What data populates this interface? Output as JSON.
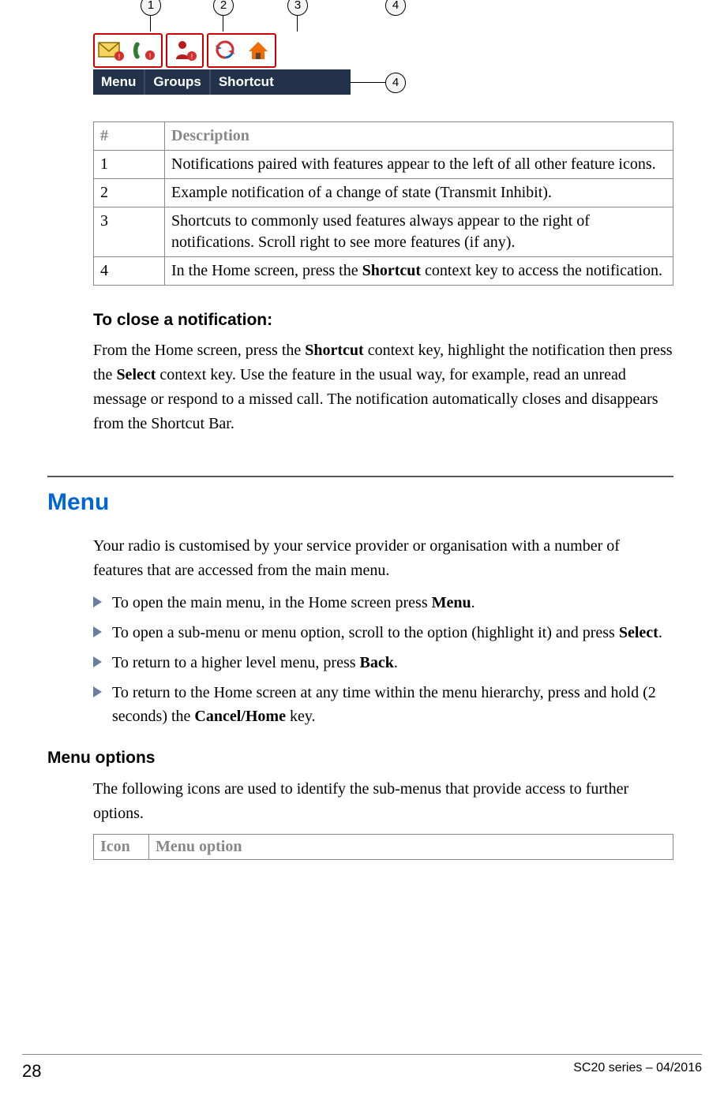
{
  "figure": {
    "callouts": [
      "1",
      "2",
      "3",
      "4"
    ],
    "menubar": [
      "Menu",
      "Groups",
      "Shortcut"
    ]
  },
  "table": {
    "headers": [
      "#",
      "Description"
    ],
    "rows": [
      {
        "n": "1",
        "d_pre": "Notifications paired with features appear to the left of all other feature icons.",
        "d_bold": "",
        "d_post": ""
      },
      {
        "n": "2",
        "d_pre": "Example notification of a change of state (Transmit Inhibit).",
        "d_bold": "",
        "d_post": ""
      },
      {
        "n": "3",
        "d_pre": "Shortcuts to commonly used features always appear to the right of notifications. Scroll right to see more features (if any).",
        "d_bold": "",
        "d_post": ""
      },
      {
        "n": "4",
        "d_pre": "In the Home screen, press the ",
        "d_bold": "Shortcut",
        "d_post": " context key to access the notification."
      }
    ]
  },
  "close_notif": {
    "title": "To close a notification:",
    "p1a": "From the Home screen, press the ",
    "p1b": "Shortcut",
    "p1c": " context key, highlight the notification then press the ",
    "p1d": "Select",
    "p1e": " context key. Use the feature in the usual way, for example, read an unread message or respond to a missed call. The notification automatically closes and disappears from the Shortcut Bar."
  },
  "menu": {
    "title": "Menu",
    "intro": "Your radio is customised by your service provider or organisation with a number of features that are accessed from the main menu.",
    "items": [
      {
        "a": "To open the main menu, in the Home screen press ",
        "b": "Menu",
        "c": "."
      },
      {
        "a": "To open a sub-menu or menu option, scroll to the option (highlight it) and press ",
        "b": "Select",
        "c": "."
      },
      {
        "a": "To return to a higher level menu, press ",
        "b": "Back",
        "c": "."
      },
      {
        "a": "To return to the Home screen at any time within the menu hierarchy, press and hold (2 seconds) the ",
        "b": "Cancel/Home",
        "c": " key."
      }
    ]
  },
  "menu_options": {
    "title": "Menu options",
    "intro": "The following icons are used to identify the sub-menus that provide access to further options.",
    "headers": [
      "Icon",
      "Menu option"
    ]
  },
  "footer": {
    "page": "28",
    "rev": "SC20 series – 04/2016"
  }
}
